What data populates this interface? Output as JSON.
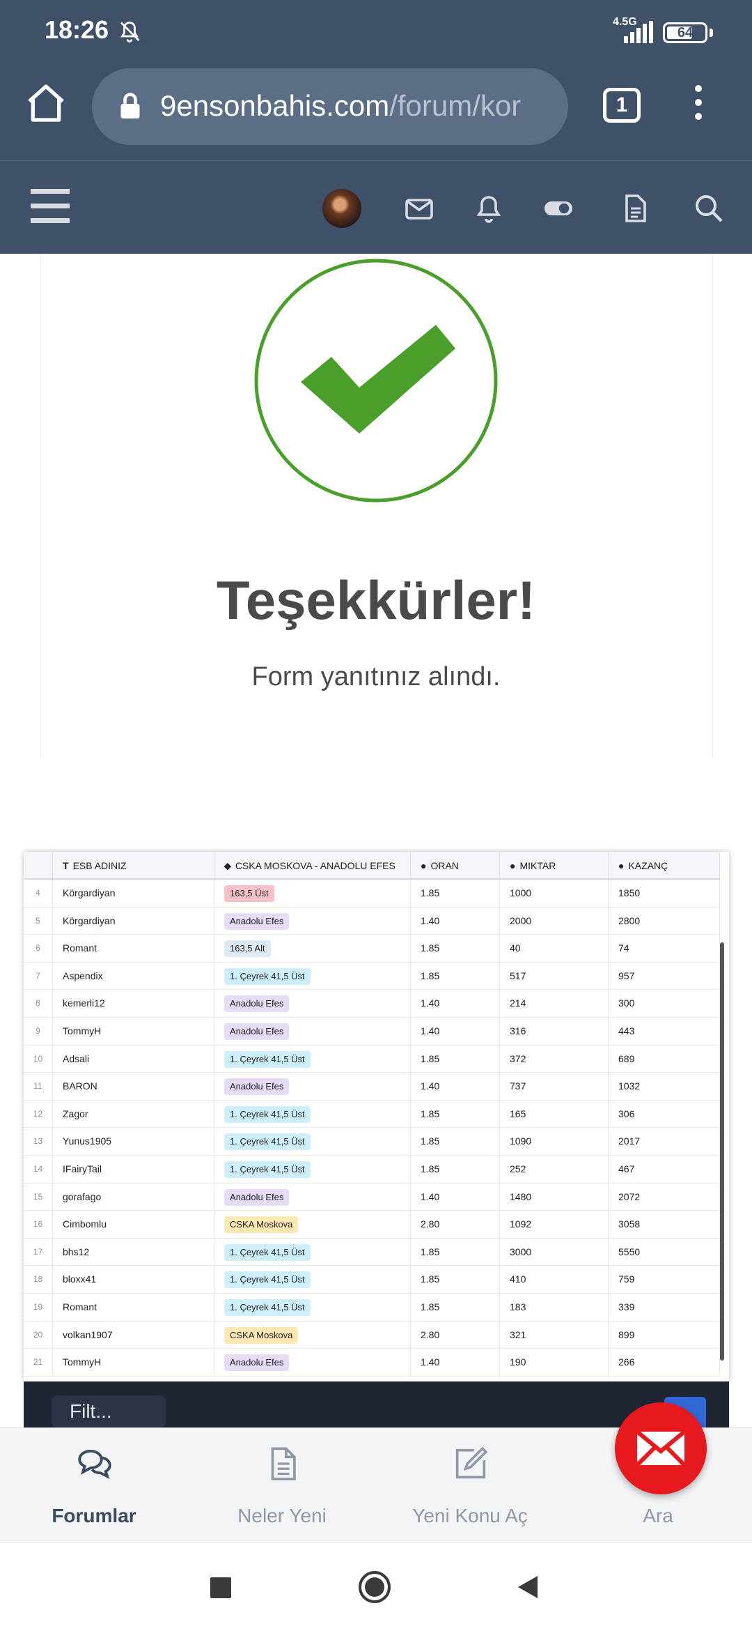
{
  "status_bar": {
    "time": "18:26",
    "network": "4.5G",
    "battery": "64"
  },
  "browser": {
    "url_domain": "9ensonbahis.com",
    "url_path": "/forum/kor",
    "tab_count": "1"
  },
  "confirmation": {
    "title": "Teşekkürler!",
    "subtitle": "Form yanıtınız alındı."
  },
  "table": {
    "headers": [
      "ESB ADINIZ",
      "CSKA MOSKOVA - ANADOLU EFES",
      "ORAN",
      "MIKTAR",
      "KAZANÇ"
    ],
    "rows": [
      {
        "n": "4",
        "name": "Körgardiyan",
        "bet": "163,5 Üst",
        "tag": "pink",
        "oran": "1.85",
        "miktar": "1000",
        "kazanc": "1850"
      },
      {
        "n": "5",
        "name": "Körgardiyan",
        "bet": "Anadolu Efes",
        "tag": "lavender",
        "oran": "1.40",
        "miktar": "2000",
        "kazanc": "2800"
      },
      {
        "n": "6",
        "name": "Romant",
        "bet": "163,5 Alt",
        "tag": "blue",
        "oran": "1.85",
        "miktar": "40",
        "kazanc": "74"
      },
      {
        "n": "7",
        "name": "Aspendix",
        "bet": "1. Çeyrek 41,5 Üst",
        "tag": "cyan",
        "oran": "1.85",
        "miktar": "517",
        "kazanc": "957"
      },
      {
        "n": "8",
        "name": "kemerli12",
        "bet": "Anadolu Efes",
        "tag": "lavender",
        "oran": "1.40",
        "miktar": "214",
        "kazanc": "300"
      },
      {
        "n": "9",
        "name": "TommyH",
        "bet": "Anadolu Efes",
        "tag": "lavender",
        "oran": "1.40",
        "miktar": "316",
        "kazanc": "443"
      },
      {
        "n": "10",
        "name": "Adsali",
        "bet": "1. Çeyrek 41,5 Üst",
        "tag": "cyan",
        "oran": "1.85",
        "miktar": "372",
        "kazanc": "689"
      },
      {
        "n": "11",
        "name": "BARON",
        "bet": "Anadolu Efes",
        "tag": "lavender",
        "oran": "1.40",
        "miktar": "737",
        "kazanc": "1032"
      },
      {
        "n": "12",
        "name": "Zagor",
        "bet": "1. Çeyrek 41,5 Üst",
        "tag": "cyan",
        "oran": "1.85",
        "miktar": "165",
        "kazanc": "306"
      },
      {
        "n": "13",
        "name": "Yunus1905",
        "bet": "1. Çeyrek 41,5 Üst",
        "tag": "cyan",
        "oran": "1.85",
        "miktar": "1090",
        "kazanc": "2017"
      },
      {
        "n": "14",
        "name": "IFairyTail",
        "bet": "1. Çeyrek 41,5 Üst",
        "tag": "cyan",
        "oran": "1.85",
        "miktar": "252",
        "kazanc": "467"
      },
      {
        "n": "15",
        "name": "gorafago",
        "bet": "Anadolu Efes",
        "tag": "lavender",
        "oran": "1.40",
        "miktar": "1480",
        "kazanc": "2072"
      },
      {
        "n": "16",
        "name": "Cimbomlu",
        "bet": "CSKA Moskova",
        "tag": "yellow",
        "oran": "2.80",
        "miktar": "1092",
        "kazanc": "3058"
      },
      {
        "n": "17",
        "name": "bhs12",
        "bet": "1. Çeyrek 41,5 Üst",
        "tag": "cyan",
        "oran": "1.85",
        "miktar": "3000",
        "kazanc": "5550"
      },
      {
        "n": "18",
        "name": "bloxx41",
        "bet": "1. Çeyrek 41,5 Üst",
        "tag": "cyan",
        "oran": "1.85",
        "miktar": "410",
        "kazanc": "759"
      },
      {
        "n": "19",
        "name": "Romant",
        "bet": "1. Çeyrek 41,5 Üst",
        "tag": "cyan",
        "oran": "1.85",
        "miktar": "183",
        "kazanc": "339"
      },
      {
        "n": "20",
        "name": "volkan1907",
        "bet": "CSKA Moskova",
        "tag": "yellow",
        "oran": "2.80",
        "miktar": "321",
        "kazanc": "899"
      },
      {
        "n": "21",
        "name": "TommyH",
        "bet": "Anadolu Efes",
        "tag": "lavender",
        "oran": "1.40",
        "miktar": "190",
        "kazanc": "266"
      }
    ],
    "footer_button": "Filt..."
  },
  "tag_colors": {
    "pink": "#f8c2c8",
    "lavender": "#e6dcf6",
    "blue": "#dfe8f5",
    "cyan": "#cdeefb",
    "yellow": "#fde8b4"
  },
  "bottom_nav": {
    "items": [
      {
        "label": "Forumlar",
        "icon": "chat-bubbles-icon"
      },
      {
        "label": "Neler Yeni",
        "icon": "document-icon"
      },
      {
        "label": "Yeni Konu Aç",
        "icon": "edit-icon"
      },
      {
        "label": "Ara",
        "icon": "search-icon"
      }
    ]
  },
  "colors": {
    "header_bg": "#3e5168",
    "check_green": "#4a9e2a",
    "fab_red": "#e8191c"
  }
}
